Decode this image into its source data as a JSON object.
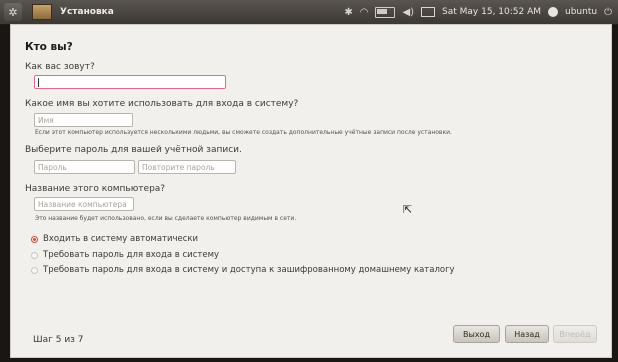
{
  "topbar": {
    "window_title": "Установка",
    "clock": "Sat May 15, 10:52 AM",
    "user": "ubuntu",
    "icons": [
      "ubuntu-menu-icon",
      "installer-icon",
      "bluetooth-icon",
      "wifi-icon",
      "battery-icon",
      "volume-icon",
      "mail-icon",
      "user-icon",
      "power-icon"
    ]
  },
  "form": {
    "heading": "Кто вы?",
    "name_label": "Как вас зовут?",
    "name_value": "",
    "login_label": "Какое имя вы хотите использовать для входа в систему?",
    "login_placeholder": "Имя",
    "login_note": "Если этот компьютер используется несколькими людьми, вы сможете создать дополнительные учётные записи после установки.",
    "password_label": "Выберите пароль для вашей учётной записи.",
    "password_placeholder": "Пароль",
    "password_repeat_placeholder": "Повторите пароль",
    "computer_label": "Название этого компьютера?",
    "computer_placeholder": "Название компьютера",
    "computer_note": "Это название будет использовано, если вы сделаете компьютер видимым в сети."
  },
  "login_options": [
    {
      "label": "Входить в систему автоматически",
      "selected": true
    },
    {
      "label": "Требовать пароль для входа в систему",
      "selected": false
    },
    {
      "label": "Требовать пароль для входа в систему и доступа к зашифрованному домашнему каталогу",
      "selected": false
    }
  ],
  "footer": {
    "step": "Шаг 5 из 7",
    "quit_label": "Выход",
    "back_label": "Назад",
    "forward_label": "Вперёд",
    "forward_enabled": false
  },
  "colors": {
    "radio_selected": "#d64a3a",
    "active_field_border": "#e56a8a"
  }
}
